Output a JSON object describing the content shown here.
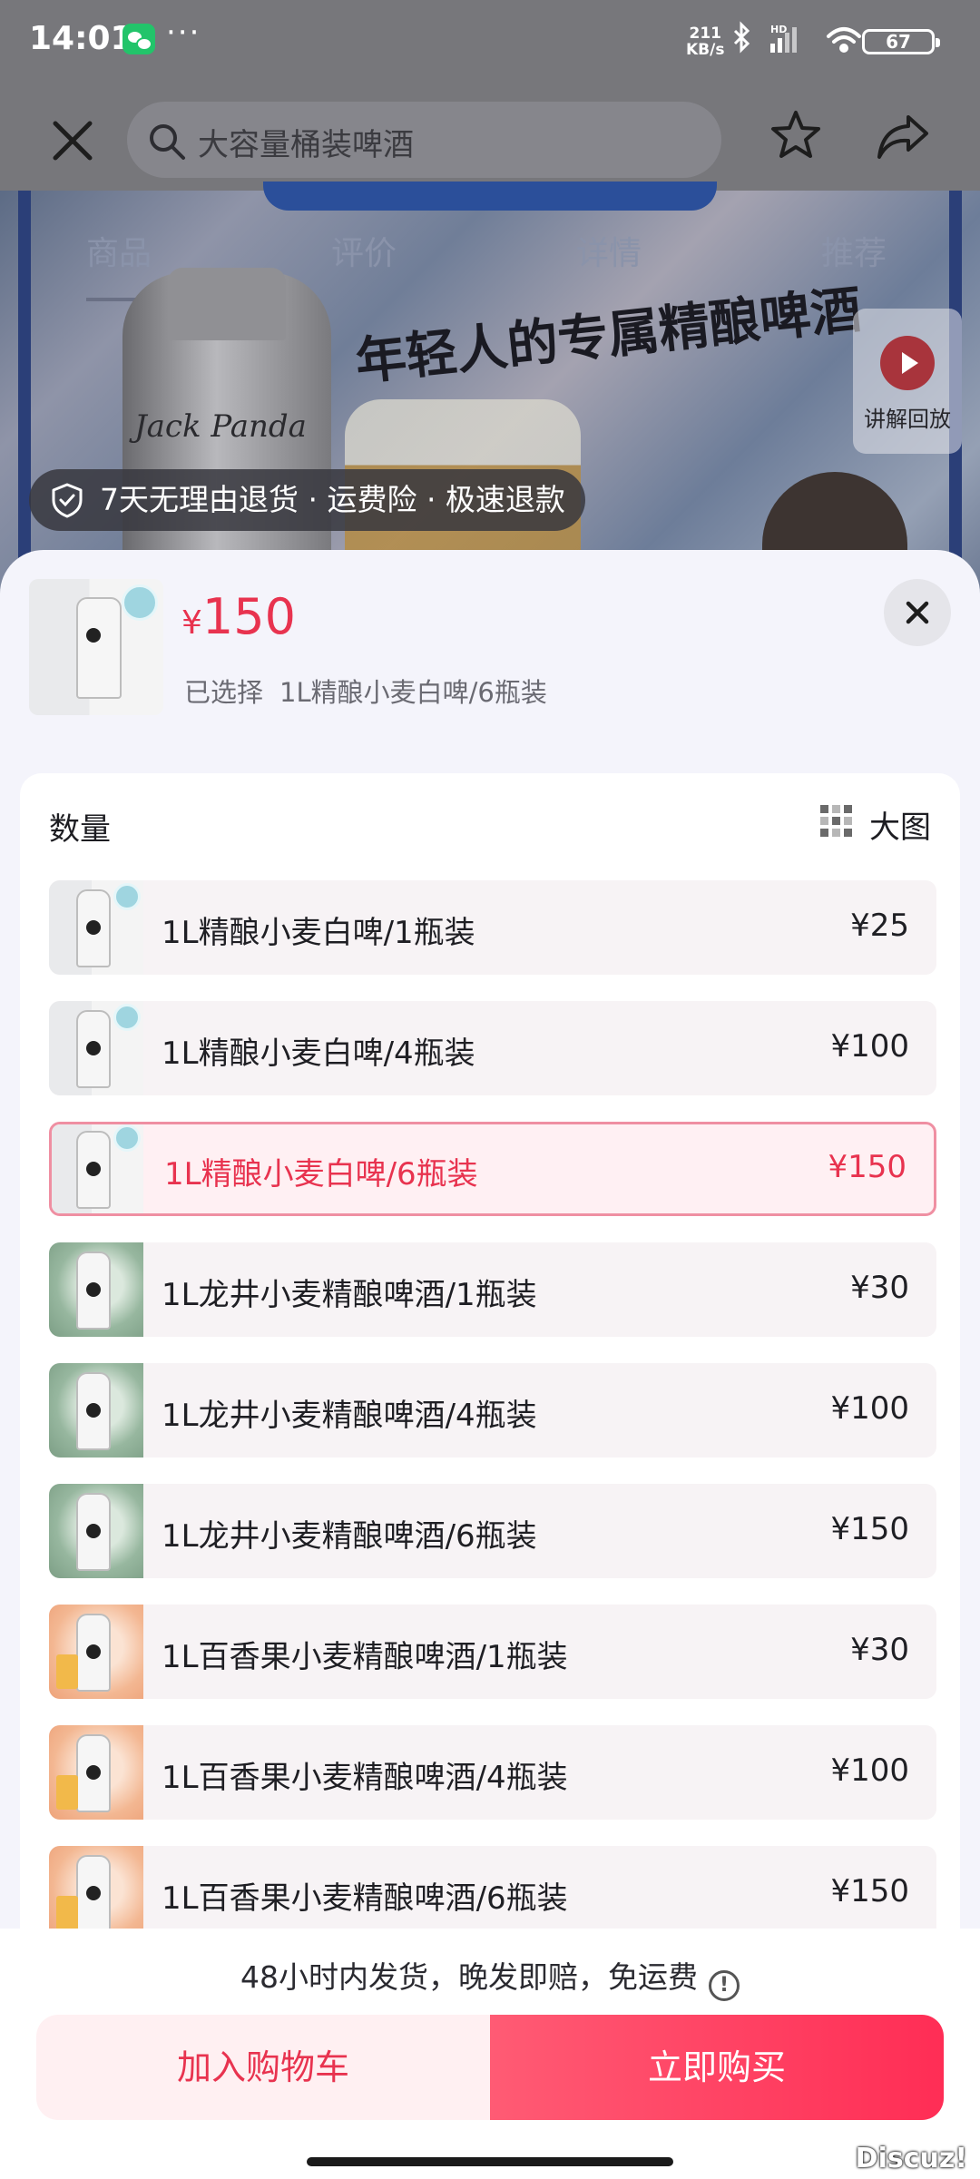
{
  "status_bar": {
    "time": "14:01",
    "dots": "···",
    "net_speed_top": "211",
    "net_speed_bottom": "KB/s",
    "battery": "67"
  },
  "nav": {
    "search_text": "大容量桶装啤酒"
  },
  "hero": {
    "tabs": [
      "商品",
      "评价",
      "详情",
      "推荐"
    ],
    "slogan": "年轻人的专属精酿啤酒",
    "bottle_brand": "Jack Panda",
    "replay_label": "讲解回放",
    "guarantee": "7天无理由退货 · 运费险 · 极速退款"
  },
  "sheet": {
    "price_symbol": "¥",
    "price": "150",
    "selected_prefix": "已选择",
    "selected_value": "1L精酿小麦白啤/6瓶装",
    "quantity_label": "数量",
    "big_view_label": "大图",
    "variants": [
      {
        "label": "1L精酿小麦白啤/1瓶装",
        "price": "¥25",
        "thumb": "white",
        "selected": false
      },
      {
        "label": "1L精酿小麦白啤/4瓶装",
        "price": "¥100",
        "thumb": "white",
        "selected": false
      },
      {
        "label": "1L精酿小麦白啤/6瓶装",
        "price": "¥150",
        "thumb": "white",
        "selected": true
      },
      {
        "label": "1L龙井小麦精酿啤酒/1瓶装",
        "price": "¥30",
        "thumb": "green",
        "selected": false
      },
      {
        "label": "1L龙井小麦精酿啤酒/4瓶装",
        "price": "¥100",
        "thumb": "green",
        "selected": false
      },
      {
        "label": "1L龙井小麦精酿啤酒/6瓶装",
        "price": "¥150",
        "thumb": "green",
        "selected": false
      },
      {
        "label": "1L百香果小麦精酿啤酒/1瓶装",
        "price": "¥30",
        "thumb": "peach",
        "selected": false
      },
      {
        "label": "1L百香果小麦精酿啤酒/4瓶装",
        "price": "¥100",
        "thumb": "peach",
        "selected": false
      },
      {
        "label": "1L百香果小麦精酿啤酒/6瓶装",
        "price": "¥150",
        "thumb": "peach",
        "selected": false
      }
    ]
  },
  "bottom": {
    "shipping_note": "48小时内发货，晚发即赔，免运费",
    "info_icon_glyph": "!",
    "add_to_cart": "加入购物车",
    "buy_now": "立即购买",
    "watermark": "Discuz!"
  },
  "colors": {
    "accent": "#e8334f",
    "buy_gradient_start": "#ff5b74",
    "buy_gradient_end": "#ff2d55",
    "sheet_bg": "#f4f4fb"
  }
}
